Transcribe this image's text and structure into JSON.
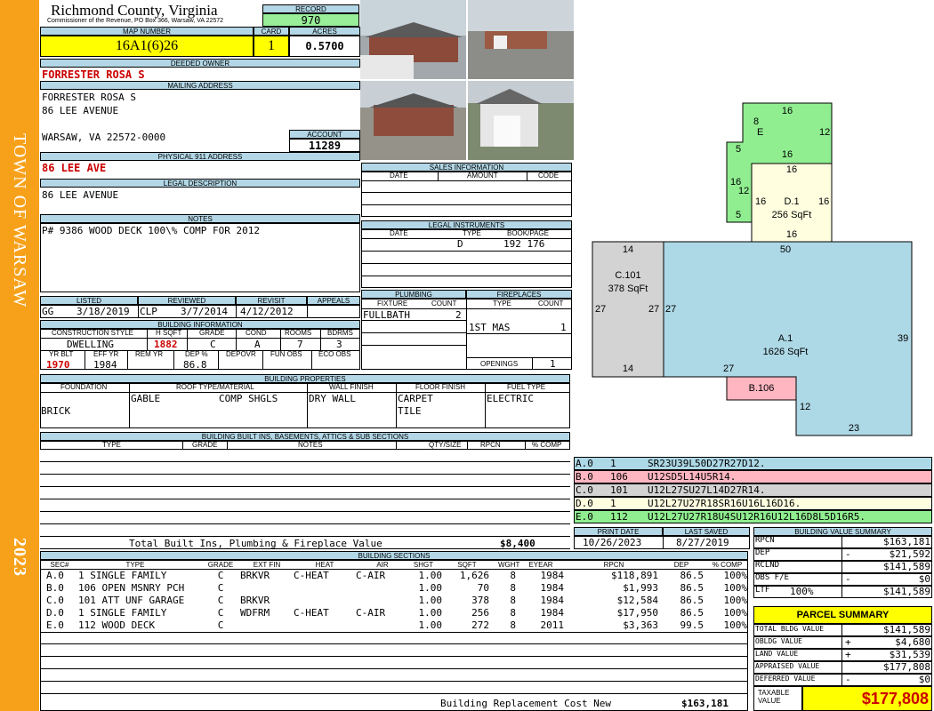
{
  "sidebar": {
    "town": "TOWN OF WARSAW",
    "year": "2023"
  },
  "header": {
    "county": "Richmond County, Virginia",
    "address": "Commissioner of the Revenue, PO Box 366, Warsaw, VA 22572",
    "record_label": "RECORD",
    "record": "970",
    "map_label": "MAP NUMBER",
    "map": "16A1(6)26",
    "card_label": "CARD",
    "card": "1",
    "acres_label": "ACRES",
    "acres": "0.5700"
  },
  "owner": {
    "deeded_label": "DEEDED OWNER",
    "deeded": "FORRESTER ROSA S",
    "mailing_label": "MAILING ADDRESS",
    "mail1": "FORRESTER ROSA S",
    "mail2": "86 LEE AVENUE",
    "mail3": "WARSAW, VA 22572-0000",
    "account_label": "ACCOUNT",
    "account": "11289",
    "physical_label": "PHYSICAL 911 ADDRESS",
    "physical": "86 LEE AVE",
    "legal_label": "LEGAL DESCRIPTION",
    "legal": "86 LEE AVENUE",
    "notes_label": "NOTES",
    "notes": "P# 9386 WOOD DECK 100\\% COMP FOR 2012"
  },
  "sales": {
    "label": "SALES INFORMATION",
    "cols": [
      "DATE",
      "AMOUNT",
      "CODE"
    ]
  },
  "legal_instruments": {
    "label": "LEGAL INSTRUMENTS",
    "cols": [
      "DATE",
      "TYPE",
      "BOOK/PAGE"
    ],
    "type": "D",
    "book": "192 176"
  },
  "plumbing": {
    "label": "PLUMBING",
    "cols": [
      "FIXTURE",
      "COUNT"
    ],
    "fixture": "FULLBATH",
    "count": "2"
  },
  "fireplaces": {
    "label": "FIREPLACES",
    "cols": [
      "TYPE",
      "COUNT"
    ],
    "type": "1ST MAS",
    "count": "1",
    "openings_label": "OPENINGS",
    "openings": "1"
  },
  "review": {
    "listed_label": "LISTED",
    "reviewed_label": "REVIEWED",
    "revisit_label": "REVISIT",
    "appeals_label": "APPEALS",
    "listed_by": "GG",
    "listed": "3/18/2019",
    "reviewed_by": "CLP",
    "reviewed": "3/7/2014",
    "revisit": "4/12/2012"
  },
  "building_info": {
    "label": "BUILDING INFORMATION",
    "cols": [
      "CONSTRUCTION STYLE",
      "H SQFT",
      "GRADE",
      "COND",
      "ROOMS",
      "BDRMS"
    ],
    "style": "DWELLING",
    "hsqft": "1882",
    "grade": "C",
    "cond": "A",
    "rooms": "7",
    "bdrms": "3",
    "cols2": [
      "YR BLT",
      "EFF YR",
      "REM YR",
      "DEP %",
      "DEPOVR",
      "FUN OBS",
      "ECO OBS"
    ],
    "yrblt": "1970",
    "effyr": "1984",
    "dep": "86.8"
  },
  "properties": {
    "label": "BUILDING PROPERTIES",
    "cols": [
      "FOUNDATION",
      "ROOF TYPE/MATERIAL",
      "WALL FINISH",
      "FLOOR FINISH",
      "FUEL TYPE"
    ],
    "foundation": "BRICK",
    "roof_type": "GABLE",
    "roof_mat": "COMP SHGLS",
    "wall": "DRY WALL",
    "floor1": "CARPET",
    "floor2": "TILE",
    "fuel": "ELECTRIC"
  },
  "builtins": {
    "label": "BUILDING BUILT INS, BASEMENTS, ATTICS & SUB SECTIONS",
    "cols": [
      "TYPE",
      "GRADE",
      "NOTES",
      "QTY/SIZE",
      "RPCN",
      "% COMP"
    ],
    "total_label": "Total Built Ins, Plumbing & Fireplace Value",
    "total": "$8,400"
  },
  "print": {
    "print_label": "PRINT DATE",
    "print": "10/26/2023",
    "saved_label": "LAST SAVED",
    "saved": "8/27/2019"
  },
  "sections": {
    "label": "BUILDING SECTIONS",
    "cols": [
      "SEC#",
      "TYPE",
      "GRADE",
      "EXT FIN",
      "HEAT",
      "AIR",
      "SHGT",
      "SQFT",
      "WGHT",
      "EYEAR",
      "RPCN",
      "DEP",
      "% COMP"
    ],
    "rows": [
      [
        "A.0",
        "1 SINGLE FAMILY",
        "C",
        "BRKVR",
        "C-HEAT",
        "C-AIR",
        "1.00",
        "1,626",
        "8",
        "1984",
        "$118,891",
        "86.5",
        "100%"
      ],
      [
        "B.0",
        "106 OPEN MSNRY PCH",
        "C",
        "",
        "",
        "",
        "1.00",
        "70",
        "8",
        "1984",
        "$1,993",
        "86.5",
        "100%"
      ],
      [
        "C.0",
        "101 ATT UNF GARAGE",
        "C",
        "BRKVR",
        "",
        "",
        "1.00",
        "378",
        "8",
        "1984",
        "$12,584",
        "86.5",
        "100%"
      ],
      [
        "D.0",
        "1 SINGLE FAMILY",
        "C",
        "WDFRM",
        "C-HEAT",
        "C-AIR",
        "1.00",
        "256",
        "8",
        "1984",
        "$17,950",
        "86.5",
        "100%"
      ],
      [
        "E.0",
        "112 WOOD DECK",
        "C",
        "",
        "",
        "",
        "1.00",
        "272",
        "8",
        "2011",
        "$3,363",
        "99.5",
        "100%"
      ]
    ],
    "brcn_label": "Building Replacement Cost New",
    "brcn": "$163,181"
  },
  "sketch_codes": [
    [
      "A.0",
      "1",
      "SR23U39L50D27R27D12."
    ],
    [
      "B.0",
      "106",
      "U12SD5L14U5R14."
    ],
    [
      "C.0",
      "101",
      "U12L27SU27L14D27R14."
    ],
    [
      "D.0",
      "1",
      "U12L27U27R18SR16U16L16D16."
    ],
    [
      "E.0",
      "112",
      "U12L27U27R18U4SU12R16U12L16D8L5D16R5."
    ]
  ],
  "sketch": {
    "a_name": "A.1",
    "a_area": "1626 SqFt",
    "c_name": "C.101",
    "c_area": "378 SqFt",
    "d_name": "D.1",
    "d_area": "256 SqFt",
    "b_name": "B.106",
    "e_name": "E",
    "dims": {
      "a_top": "50",
      "a_right": "39",
      "a_left": "27",
      "a_bottom": "23",
      "a_step_h": "27",
      "a_step_v": "12",
      "c_top": "14",
      "c_bottom": "14",
      "c_left": "27",
      "c_right": "27",
      "d_top": "16",
      "d_bottom": "16",
      "d_left": "16",
      "d_right": "16",
      "e_top": "16",
      "e_right": "12",
      "e_left_top": "8",
      "e_left_mid": "5",
      "e_left": "12",
      "e_left_low": "16",
      "e_left_bot": "5",
      "e_bottom": "16"
    }
  },
  "value_summary": {
    "label": "BUILDING VALUE SUMMARY",
    "rows": [
      {
        "k": "RPCN",
        "sign": "",
        "v": "$163,181"
      },
      {
        "k": "DEP",
        "sign": "-",
        "v": "$21,592"
      },
      {
        "k": "RCLND",
        "sign": "",
        "v": "$141,589"
      },
      {
        "k": "OBS F/E",
        "sign": "-",
        "v": "$0"
      },
      {
        "k": "LTF",
        "sign": "100%",
        "v": "$141,589"
      }
    ]
  },
  "parcel": {
    "label": "PARCEL SUMMARY",
    "rows": [
      {
        "k": "TOTAL BLDG VALUE",
        "sign": "",
        "v": "$141,589"
      },
      {
        "k": "OBLDG VALUE",
        "sign": "+",
        "v": "$4,680"
      },
      {
        "k": "LAND VALUE",
        "sign": "+",
        "v": "$31,539"
      },
      {
        "k": "APPRAISED VALUE",
        "sign": "",
        "v": "$177,808"
      },
      {
        "k": "DEFERRED VALUE",
        "sign": "-",
        "v": "$0"
      }
    ],
    "taxable_label": "TAXABLE VALUE",
    "taxable": "$177,808"
  },
  "colors": {
    "sidebar": "#f7a11a",
    "header": "#b3d7e6",
    "highlight": "#ffff00",
    "green": "#99ee99",
    "a": "#add8e6",
    "b": "#ffb6c1",
    "c": "#d3d3d3",
    "d": "#ffffe0",
    "e": "#90ee90"
  }
}
